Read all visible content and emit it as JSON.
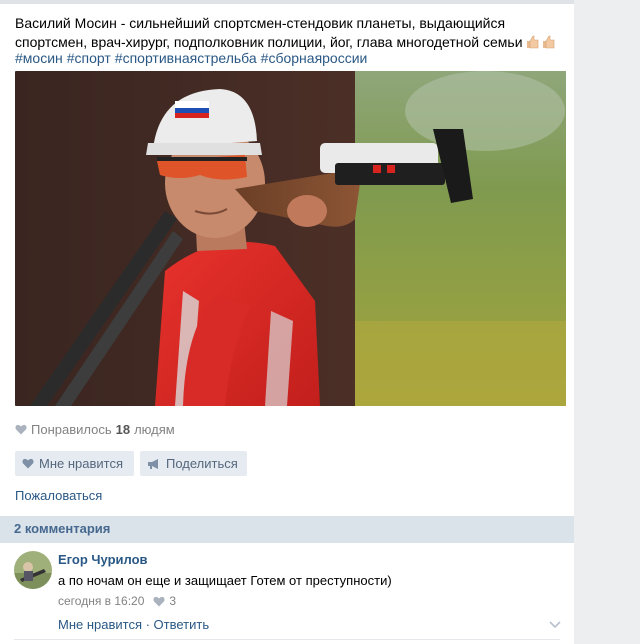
{
  "post": {
    "text": "Василий Мосин - сильнейший спортсмен-стендовик планеты, выдающийся спортсмен, врач-хирург, подполковник полиции, йог, глава многодетной семьи",
    "emoji": "thumbs-up-icon x2",
    "hashtags": [
      "#мосин",
      "#спорт",
      "#спортивнаястрельба",
      "#сборнаяроссии"
    ],
    "photo_icon": "photo-shooter-with-shotgun"
  },
  "likes": {
    "prefix": "Понравилось",
    "count": "18",
    "suffix": "людям",
    "icon": "heart-icon"
  },
  "actions": {
    "like_label": "Мне нравится",
    "share_label": "Поделиться",
    "report_label": "Пожаловаться"
  },
  "comments": {
    "header": "2 комментария",
    "items": [
      {
        "author": "Егор Чурилов",
        "text": "а по ночам он еще и защищает Готем от преступности)",
        "time": "сегодня в 16:20",
        "likes": "3",
        "actions": "Мне нравится · Ответить"
      }
    ]
  },
  "colors": {
    "link": "#2a5885",
    "header_bg": "#dae2ea",
    "button_bg": "#e5ebf1",
    "muted": "#828282"
  }
}
